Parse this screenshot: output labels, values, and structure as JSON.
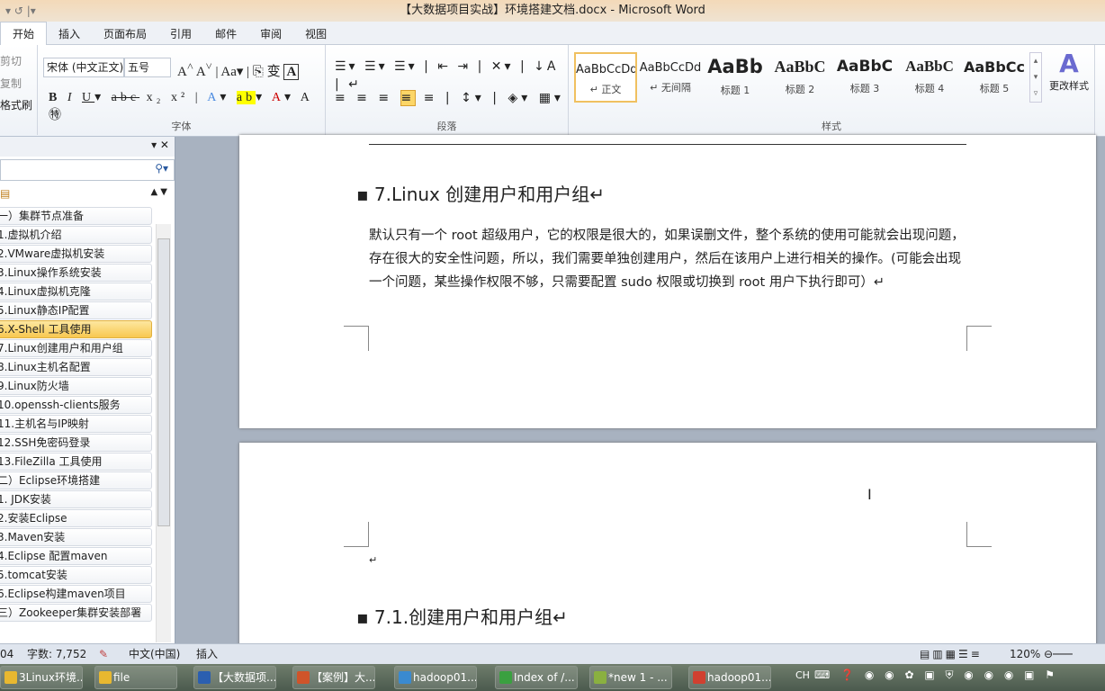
{
  "window": {
    "title": "【大数据项目实战】环境搭建文档.docx - Microsoft Word"
  },
  "tabs": [
    "开始",
    "插入",
    "页面布局",
    "引用",
    "邮件",
    "审阅",
    "视图"
  ],
  "clipboard": {
    "cut": "剪切",
    "copy": "复制",
    "format_painter": "格式刷"
  },
  "font": {
    "name": "宋体 (中文正文)",
    "size": "五号",
    "group_label": "字体"
  },
  "paragraph": {
    "group_label": "段落"
  },
  "styles": {
    "group_label": "样式",
    "change_styles": "更改样式",
    "items": [
      {
        "sample": "AaBbCcDd",
        "name": "↵ 正文"
      },
      {
        "sample": "AaBbCcDd",
        "name": "↵ 无间隔"
      },
      {
        "sample": "AaBb",
        "name": "标题 1"
      },
      {
        "sample": "AaBbC",
        "name": "标题 2"
      },
      {
        "sample": "AaBbC",
        "name": "标题 3"
      },
      {
        "sample": "AaBbC",
        "name": "标题 4"
      },
      {
        "sample": "AaBbCc",
        "name": "标题 5"
      }
    ]
  },
  "nav": {
    "selected_index": 6,
    "items": [
      "一）集群节点准备",
      "1.虚拟机介绍",
      "2.VMware虚拟机安装",
      "3.Linux操作系统安装",
      "4.Linux虚拟机克隆",
      "5.Linux静态IP配置",
      "6.X-Shell 工具使用",
      "7.Linux创建用户和用户组",
      "8.Linux主机名配置",
      "9.Linux防火墙",
      "10.openssh-clients服务",
      "11.主机名与IP映射",
      "12.SSH免密码登录",
      "13.FileZilla 工具使用",
      "二）Eclipse环境搭建",
      "1. JDK安装",
      "2.安装Eclipse",
      "3.Maven安装",
      "4.Eclipse 配置maven",
      "5.tomcat安装",
      "6.Eclipse构建maven项目",
      "三）Zookeeper集群安装部署"
    ]
  },
  "document": {
    "heading1": "7.Linux 创建用户和用户组↵",
    "body": "默认只有一个 root 超级用户，它的权限是很大的，如果误删文件，整个系统的使用可能就会出现问题，存在很大的安全性问题，所以，我们需要单独创建用户，然后在该用户上进行相关的操作。(可能会出现一个问题，某些操作权限不够，只需要配置 sudo 权限或切换到 root 用户下执行即可）↵",
    "empty_para": "↵",
    "heading2": "7.1.创建用户和用户组↵"
  },
  "status": {
    "page": "04",
    "word_count": "字数: 7,752",
    "language": "中文(中国)",
    "mode": "插入",
    "zoom": "120%"
  },
  "taskbar": [
    {
      "label": "3Linux环境...",
      "color": "#e8b830"
    },
    {
      "label": "file",
      "color": "#e8b830"
    },
    {
      "label": "【大数据项...",
      "color": "#2b5fb0"
    },
    {
      "label": "【案例】大...",
      "color": "#d0542a"
    },
    {
      "label": "hadoop01...",
      "color": "#3a8ad0"
    },
    {
      "label": "Index of /...",
      "color": "#3aa040"
    },
    {
      "label": "*new 1 - ...",
      "color": "#8ab040"
    },
    {
      "label": "hadoop01...",
      "color": "#d04030"
    }
  ],
  "tray": {
    "lang": "CH"
  }
}
